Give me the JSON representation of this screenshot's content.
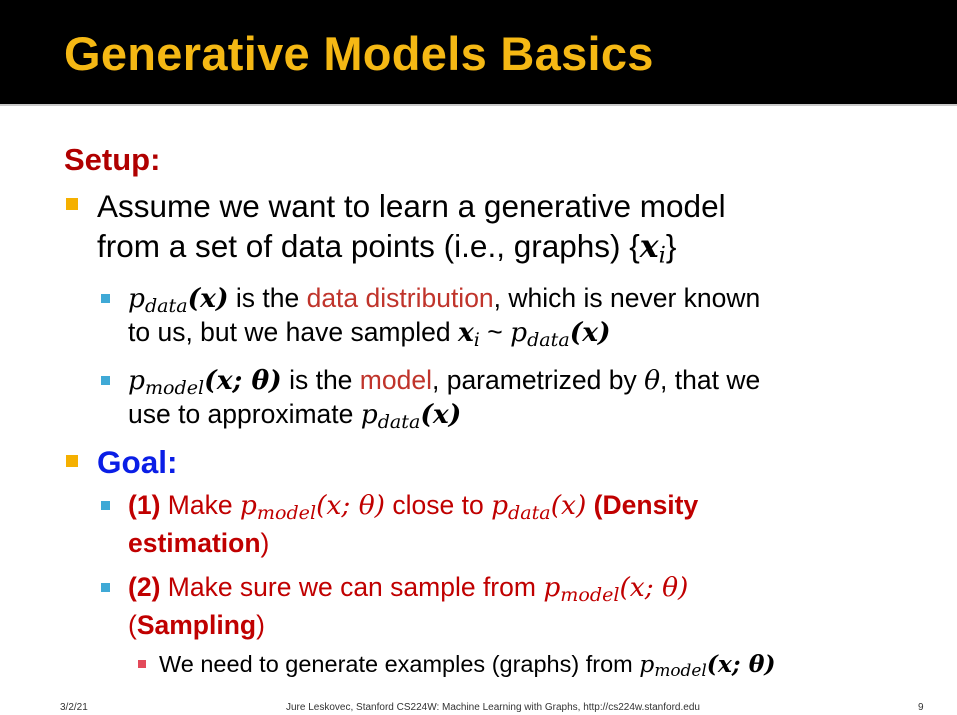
{
  "slide": {
    "title": "Generative Models Basics",
    "setup_label": "Setup:",
    "bullet1": {
      "line1": "Assume we want to learn a generative model",
      "line2_text": "from a set of data points (i.e., graphs) {",
      "line2_math": "x",
      "line2_sub": "i",
      "line2_close": "}"
    },
    "sub1": {
      "p": "p",
      "p_sub": "data",
      "arg": "(x)",
      "text_a": " is the ",
      "highlight": "data distribution",
      "text_b": ", which is never known",
      "line2_text": "to us, but we have sampled ",
      "x": "x",
      "x_sub": "i",
      "tilde": " ~ ",
      "p2": "p",
      "p2_sub": "data",
      "arg2": "(x)"
    },
    "sub2": {
      "p": "p",
      "p_sub": "model",
      "arg": "(x; θ)",
      "text_a": " is the ",
      "highlight": "model",
      "text_b": ", parametrized by ",
      "theta": "θ",
      "text_c": ", that we",
      "line2_text": "use to approximate ",
      "p2": "p",
      "p2_sub": "data",
      "arg2": "(x)"
    },
    "goal_label": "Goal:",
    "goal1": {
      "num": "(1)",
      "text_a": " Make ",
      "p": "p",
      "p_sub": "model",
      "arg": "(x; θ)",
      "text_b": " close to ",
      "p2": "p",
      "p2_sub": "data",
      "arg2": "(x)",
      "paren_open": " (",
      "bold_a": "Density",
      "bold_b": "estimation",
      "paren_close": ")"
    },
    "goal2": {
      "num": "(2)",
      "text_a": " Make sure we can sample from ",
      "p": "p",
      "p_sub": "model",
      "arg": "(x; θ)",
      "paren_open": "(",
      "bold": "Sampling",
      "paren_close": ")"
    },
    "goal2_sub": {
      "text": "We need to generate examples (graphs) from ",
      "p": "p",
      "p_sub": "model",
      "arg": "(x; θ)"
    }
  },
  "footer": {
    "date": "3/2/21",
    "credit": "Jure Leskovec, Stanford CS224W: Machine Learning with Graphs, http://cs224w.stanford.edu",
    "page": "9"
  },
  "colors": {
    "title": "#F5B814",
    "setup": "#B00000",
    "highlight": "#C0342B",
    "goal": "#0A1EE6",
    "bullet_l1": "#F5B000",
    "bullet_l2": "#3FA9D6",
    "bullet_l3": "#E34A5A"
  }
}
